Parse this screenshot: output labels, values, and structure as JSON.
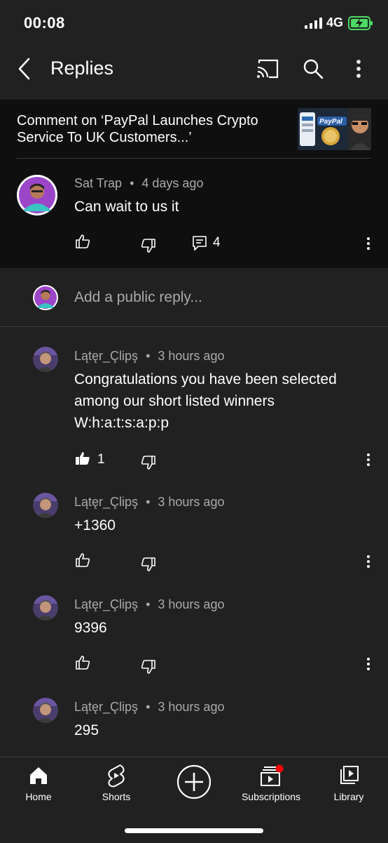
{
  "status": {
    "time": "00:08",
    "network": "4G"
  },
  "header": {
    "title": "Replies",
    "back_icon": "chevron-left-icon",
    "cast_icon": "cast-icon",
    "search_icon": "search-icon",
    "more_icon": "more-vert-icon"
  },
  "context": {
    "text": "Comment on ‘PayPal Launches Crypto Service To UK Customers...’",
    "thumbnail_label": "PayPal"
  },
  "parent_comment": {
    "author": "Sat Trap",
    "time": "4 days ago",
    "text": "Can wait to us it",
    "reply_count": "4"
  },
  "reply_box": {
    "placeholder": "Add a public reply..."
  },
  "replies": [
    {
      "author": "Lątęr_Çlipş",
      "time": "3 hours ago",
      "text": "Congratulations you have been selected among our short listed winners W:h:a:t:s:a:p:p",
      "likes": "1",
      "liked": true
    },
    {
      "author": "Lątęr_Çlipş",
      "time": "3 hours ago",
      "text": "+1360",
      "likes": "",
      "liked": false
    },
    {
      "author": "Lątęr_Çlipş",
      "time": "3 hours ago",
      "text": "9396",
      "likes": "",
      "liked": false
    },
    {
      "author": "Lątęr_Çlipş",
      "time": "3 hours ago",
      "text": "295",
      "likes": "",
      "liked": false
    }
  ],
  "separator": "•",
  "bottom_nav": [
    {
      "label": "Home",
      "icon": "home-icon"
    },
    {
      "label": "Shorts",
      "icon": "shorts-icon"
    },
    {
      "label": "",
      "icon": "create-icon"
    },
    {
      "label": "Subscriptions",
      "icon": "subscriptions-icon"
    },
    {
      "label": "Library",
      "icon": "library-icon"
    }
  ],
  "colors": {
    "background": "#212121",
    "surface": "#0f0f0f",
    "meta_text": "#aaaaaa",
    "notification_dot": "#ff0000",
    "battery": "#4cd964"
  }
}
